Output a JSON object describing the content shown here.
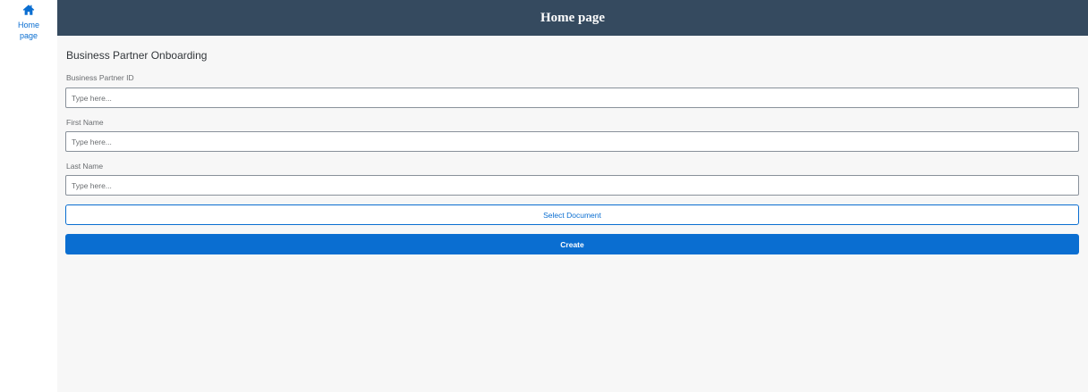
{
  "sidebar": {
    "home": {
      "icon": "home-icon",
      "label": "Home page"
    }
  },
  "header": {
    "title": "Home page"
  },
  "form": {
    "title": "Business Partner Onboarding",
    "fields": [
      {
        "label": "Business Partner ID",
        "value": "",
        "placeholder": "Type here..."
      },
      {
        "label": "First Name",
        "value": "",
        "placeholder": "Type here..."
      },
      {
        "label": "Last Name",
        "value": "",
        "placeholder": "Type here..."
      }
    ],
    "select_document_label": "Select Document",
    "create_label": "Create"
  },
  "colors": {
    "shell_header": "#354a5f",
    "accent": "#0a6ed1",
    "background": "#f7f7f7"
  }
}
